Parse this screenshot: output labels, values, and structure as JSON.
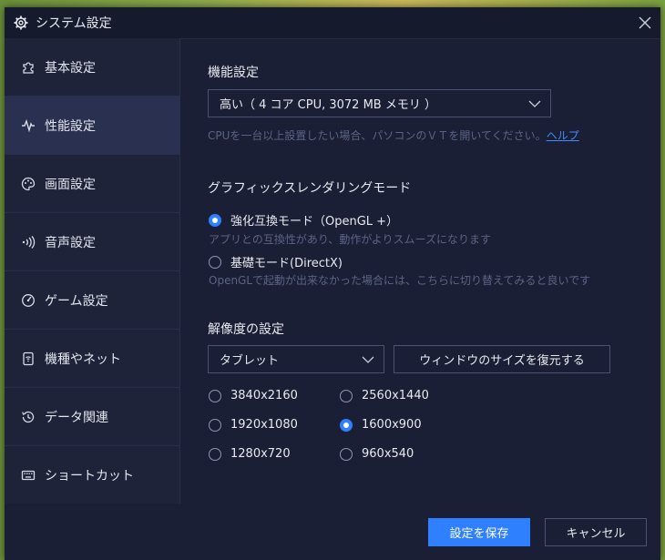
{
  "window": {
    "title": "システム設定"
  },
  "sidebar": {
    "items": [
      {
        "label": "基本設定",
        "icon": "puzzle-icon"
      },
      {
        "label": "性能設定",
        "icon": "pulse-icon"
      },
      {
        "label": "画面設定",
        "icon": "palette-icon"
      },
      {
        "label": "音声設定",
        "icon": "sound-icon"
      },
      {
        "label": "ゲーム設定",
        "icon": "gamepad-icon"
      },
      {
        "label": "機種やネット",
        "icon": "device-icon"
      },
      {
        "label": "データ関連",
        "icon": "history-icon"
      },
      {
        "label": "ショートカット",
        "icon": "keyboard-icon"
      }
    ],
    "active_index": 1
  },
  "performance": {
    "heading": "機能設定",
    "selected": "高い（ 4 コア CPU, 3072 MB メモリ ）",
    "hint_text": "CPUを一台以上設置したい場合、パソコンのＶＴを開いてください。",
    "hint_link": "ヘルプ"
  },
  "graphics": {
    "heading": "グラフィックスレンダリングモード",
    "option1_label": "強化互換モード（OpenGL +）",
    "option1_desc": "アプリとの互換性があり、動作がよりスムーズになります",
    "option2_label": "基礎モード(DirectX)",
    "option2_desc": "OpenGLで起動が出来なかった場合には、こちらに切り替えてみると良いです",
    "selected": "option1"
  },
  "resolution": {
    "heading": "解像度の設定",
    "device_selected": "タブレット",
    "restore_button": "ウィンドウのサイズを復元する",
    "options": [
      "3840x2160",
      "2560x1440",
      "1920x1080",
      "1600x900",
      "1280x720",
      "960x540"
    ],
    "selected": "1600x900"
  },
  "footer": {
    "save_label": "設定を保存",
    "cancel_label": "キャンセル"
  },
  "colors": {
    "accent": "#2f80ff",
    "panel": "#1b1f35",
    "sidebar": "#1e2339"
  }
}
